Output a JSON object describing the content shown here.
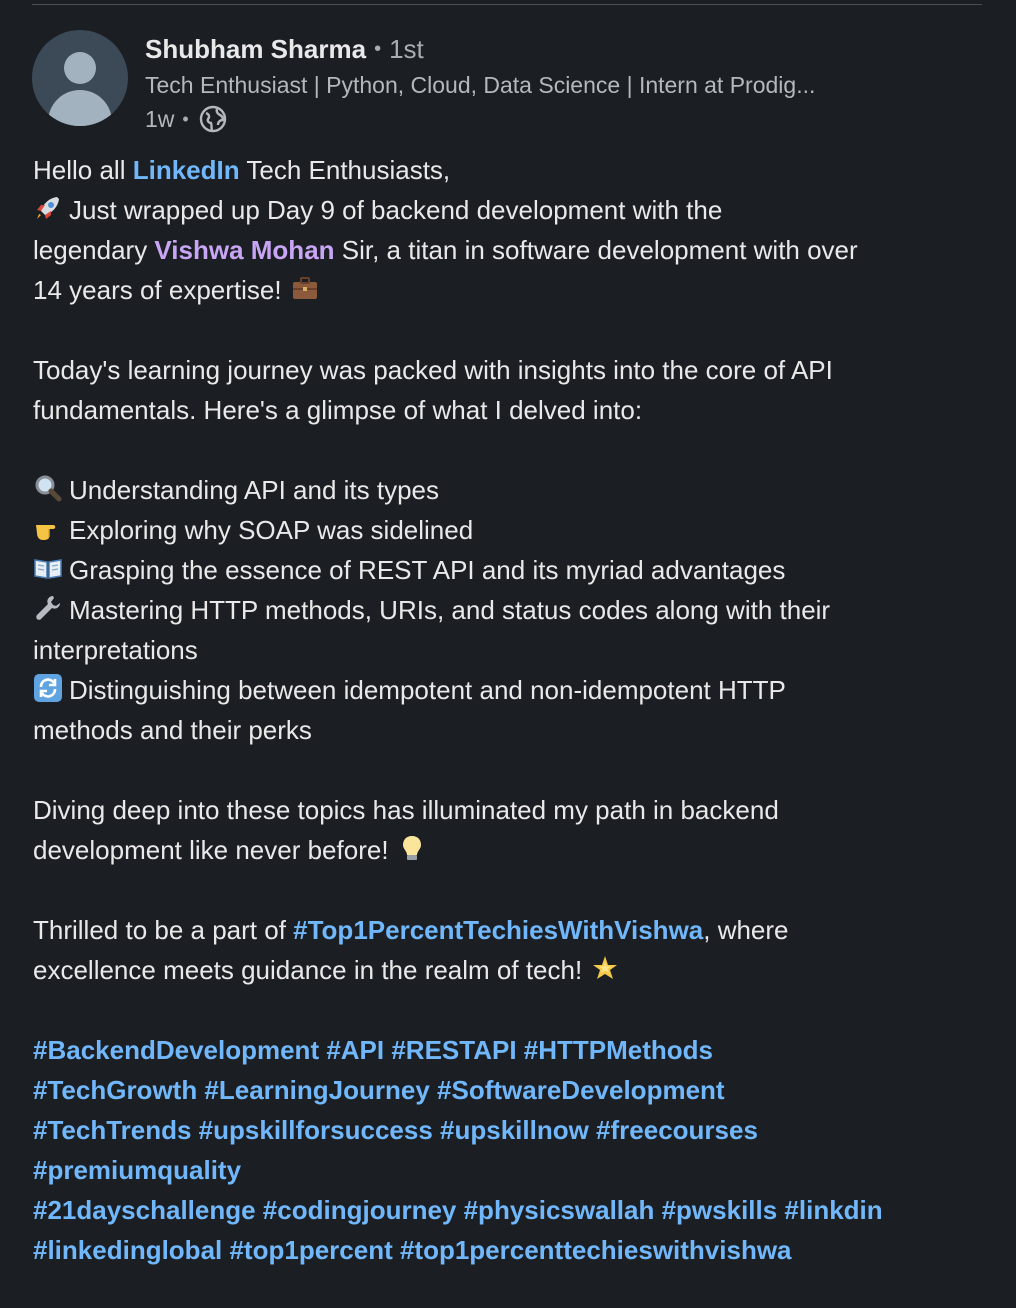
{
  "post": {
    "author": {
      "name": "Shubham Sharma",
      "separator": "•",
      "degree": "1st",
      "headline": "Tech Enthusiast | Python, Cloud, Data Science | Intern at Prodig...",
      "time": "1w",
      "time_separator": "•",
      "visibility_icon": "globe-icon"
    },
    "body": {
      "greeting_pre": "Hello all ",
      "greeting_mention": "LinkedIn",
      "greeting_post": " Tech Enthusiasts,",
      "intro_line1": "Just wrapped up Day 9 of backend development with the",
      "intro_line2_pre": "legendary ",
      "intro_mention": "Vishwa Mohan",
      "intro_line2_post": " Sir, a titan in software development with over",
      "intro_line3": "14 years of expertise!",
      "journey_line1": "Today's learning journey was packed with insights into the core of API",
      "journey_line2": "fundamentals. Here's a glimpse of what I delved into:",
      "bullets": {
        "b1": "Understanding API and its types",
        "b2": "Exploring why SOAP was sidelined",
        "b3": "Grasping the essence of REST API and its myriad advantages",
        "b4_line1": "Mastering HTTP methods, URIs, and status codes along with their",
        "b4_line2": "interpretations",
        "b5_line1": "Distinguishing between idempotent and non-idempotent HTTP",
        "b5_line2": "methods and their perks"
      },
      "diving_line1": "Diving deep into these topics has illuminated my path in backend",
      "diving_line2": "development like never before!",
      "thrilled_pre": "Thrilled to be a part of ",
      "thrilled_hashtag": "#Top1PercentTechiesWithVishwa",
      "thrilled_post": ", where",
      "excellence_line": "excellence meets guidance in the realm of tech!",
      "hashtag_lines": {
        "h1": "#BackendDevelopment #API #RESTAPI #HTTPMethods",
        "h2": "#TechGrowth #LearningJourney #SoftwareDevelopment",
        "h3": "#TechTrends #upskillforsuccess #upskillnow #freecourses",
        "h4": "#premiumquality",
        "h5": "#21dayschallenge #codingjourney #physicswallah #pwskills #linkdin",
        "h6": "#linkedinglobal #top1percent #top1percenttechieswithvishwa"
      }
    },
    "emoji_icons": [
      "rocket-icon",
      "briefcase-icon",
      "magnifier-icon",
      "pointing-hand-icon",
      "open-book-icon",
      "wrench-icon",
      "arrows-cycle-icon",
      "light-bulb-icon",
      "glowing-star-icon"
    ],
    "colors": {
      "background": "#1b1f23",
      "text": "#e9e9e9",
      "secondary_text": "#b4b8bc",
      "link": "#71b7fb",
      "mention_purple": "#c9a6f5"
    }
  }
}
